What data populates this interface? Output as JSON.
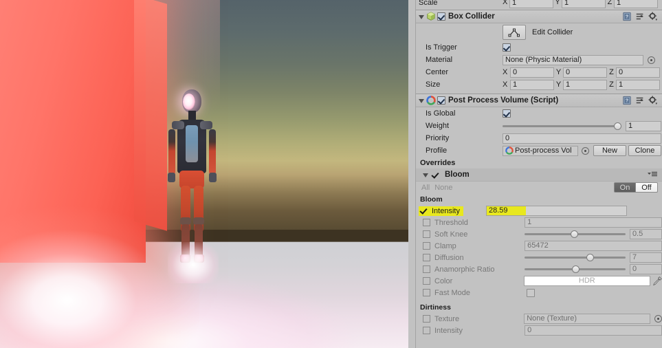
{
  "game_view": {
    "name": "game-view",
    "scene_description": "Humanoid robot character with glowing face standing near a red emissive wall with strong bloom",
    "colors": {
      "wall": "#ff7468",
      "sky_top": "#55636a",
      "sky_horizon": "#c3b77e",
      "ground": "#d4d2d6",
      "bloom_glow": "#ffffff"
    }
  },
  "inspector": {
    "scale_row": {
      "label": "Scale",
      "axes": [
        {
          "axis": "X",
          "value": "1"
        },
        {
          "axis": "Y",
          "value": "1"
        },
        {
          "axis": "Z",
          "value": "1"
        }
      ]
    },
    "box_collider": {
      "title": "Box Collider",
      "enabled": true,
      "icons": [
        "help-icon",
        "preset-icon",
        "gear-icon"
      ],
      "edit_collider_label": "Edit Collider",
      "is_trigger": {
        "label": "Is Trigger",
        "checked": true
      },
      "material": {
        "label": "Material",
        "value": "None (Physic Material)"
      },
      "center": {
        "label": "Center",
        "axes": [
          {
            "axis": "X",
            "value": "0"
          },
          {
            "axis": "Y",
            "value": "0"
          },
          {
            "axis": "Z",
            "value": "0"
          }
        ]
      },
      "size": {
        "label": "Size",
        "axes": [
          {
            "axis": "X",
            "value": "1"
          },
          {
            "axis": "Y",
            "value": "1"
          },
          {
            "axis": "Z",
            "value": "1"
          }
        ]
      }
    },
    "post_process_volume": {
      "title": "Post Process Volume (Script)",
      "enabled": true,
      "icons": [
        "help-icon",
        "preset-icon",
        "gear-icon"
      ],
      "is_global": {
        "label": "Is Global",
        "checked": true
      },
      "weight": {
        "label": "Weight",
        "value": "1",
        "slider_percent": 100
      },
      "priority": {
        "label": "Priority",
        "value": "0"
      },
      "profile": {
        "label": "Profile",
        "value": "Post-process Vol",
        "new_label": "New",
        "clone_label": "Clone"
      },
      "overrides_label": "Overrides",
      "bloom_effect": {
        "title": "Bloom",
        "enabled": true,
        "all_label": "All",
        "none_label": "None",
        "toggle_on_label": "On",
        "toggle_off_label": "Off",
        "toggle_state": "On",
        "section_bloom_label": "Bloom",
        "section_dirtiness_label": "Dirtiness",
        "parameters": [
          {
            "label": "Intensity",
            "value": "28.59",
            "override": true,
            "control": "text",
            "highlighted": true
          },
          {
            "label": "Threshold",
            "value": "1",
            "override": false,
            "control": "text",
            "highlighted": false
          },
          {
            "label": "Soft Knee",
            "value": "0.5",
            "override": false,
            "control": "slider",
            "slider_percent": 47,
            "highlighted": false
          },
          {
            "label": "Clamp",
            "value": "65472",
            "override": false,
            "control": "text",
            "highlighted": false
          },
          {
            "label": "Diffusion",
            "value": "7",
            "override": false,
            "control": "slider",
            "slider_percent": 63,
            "highlighted": false
          },
          {
            "label": "Anamorphic Ratio",
            "value": "0",
            "override": false,
            "control": "slider",
            "slider_percent": 48,
            "highlighted": false
          },
          {
            "label": "Color",
            "value": "HDR",
            "override": false,
            "control": "color",
            "highlighted": false
          },
          {
            "label": "Fast Mode",
            "value": "",
            "override": false,
            "control": "checkbox",
            "highlighted": false
          }
        ],
        "dirtiness_parameters": [
          {
            "label": "Texture",
            "value": "None (Texture)",
            "override": false,
            "control": "object"
          },
          {
            "label": "Intensity",
            "value": "0",
            "override": false,
            "control": "text"
          }
        ]
      }
    }
  }
}
